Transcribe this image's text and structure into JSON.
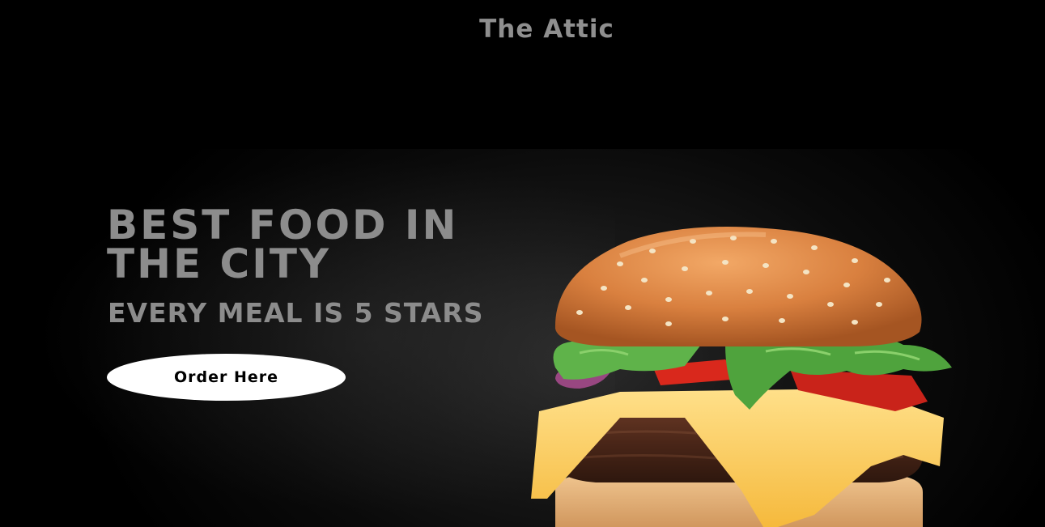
{
  "header": {
    "title": "The Attic"
  },
  "hero": {
    "headline": "BEST FOOD IN THE CITY",
    "subheadline": "EVERY MEAL IS 5 STARS",
    "cta_label": "Order Here"
  },
  "image": {
    "subject": "burger-image"
  },
  "colors": {
    "background": "#000000",
    "text": "#8c8c8c",
    "button_bg": "#ffffff",
    "button_text": "#000000"
  }
}
